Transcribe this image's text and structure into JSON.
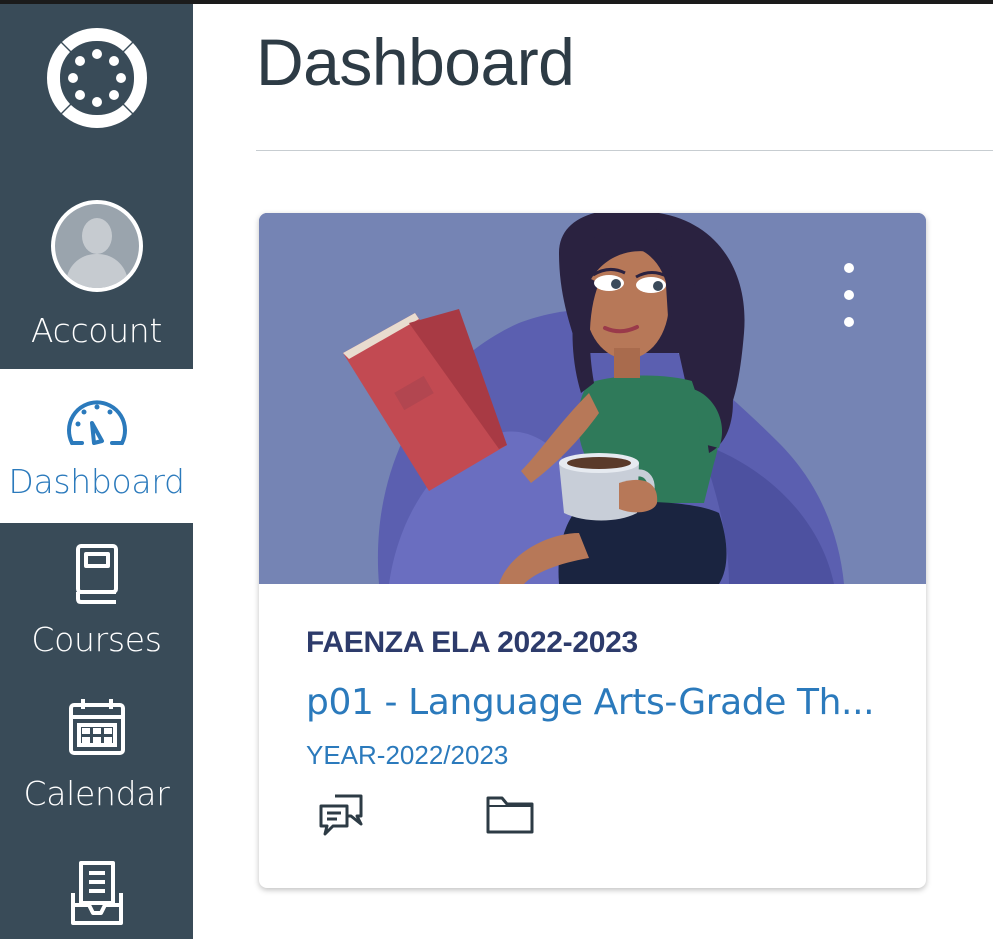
{
  "nav": {
    "account_label": "Account",
    "dashboard_label": "Dashboard",
    "courses_label": "Courses",
    "calendar_label": "Calendar"
  },
  "page": {
    "title": "Dashboard"
  },
  "course_card": {
    "term": "FAENZA ELA 2022-2023",
    "name": "p01 - Language Arts-Grade Th...",
    "code": "YEAR-2022/2023",
    "hero_color": "#7584b4",
    "icons": [
      "discussions-icon",
      "files-icon"
    ]
  },
  "colors": {
    "nav_bg": "#394b58",
    "accent": "#2b7abc",
    "title_text": "#2d3b45"
  }
}
